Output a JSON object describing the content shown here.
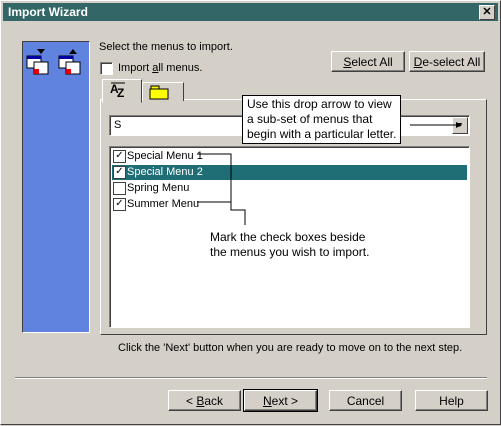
{
  "window": {
    "title": "Import Wizard",
    "close_glyph": "✕"
  },
  "prompt": "Select the menus to import.",
  "import_all": {
    "label_pre": "Import ",
    "label_ul": "a",
    "label_post": "ll menus.",
    "checked": false
  },
  "buttons": {
    "select_all_ul": "S",
    "select_all_rest": "elect All",
    "deselect_all_ul": "D",
    "deselect_all_rest": "e-select All",
    "back_ul": "B",
    "back_rest": "ack",
    "back_arrow": "<",
    "next_ul": "N",
    "next_rest": "ext",
    "next_arrow": ">",
    "cancel": "Cancel",
    "help": "Help"
  },
  "tabs": [
    {
      "icon": "az-sort-icon"
    },
    {
      "icon": "folder-icon"
    }
  ],
  "filter": {
    "value": "S",
    "arrow": "▼"
  },
  "menus": [
    {
      "label": "Special Menu 1",
      "checked": true,
      "selected": false
    },
    {
      "label": "Special Menu 2",
      "checked": true,
      "selected": true
    },
    {
      "label": "Spring Menu",
      "checked": false,
      "selected": false
    },
    {
      "label": "Summer Menu",
      "checked": true,
      "selected": false
    }
  ],
  "callout_dropdown": {
    "line1": "Use this drop arrow to view",
    "line2": "a sub-set of menus that",
    "line3": "begin with a particular letter."
  },
  "callout_checkboxes": {
    "line1": "Mark the check boxes beside",
    "line2": "the menus you wish to import."
  },
  "footer_hint": "Click the 'Next' button when you are ready to move on to the next step.",
  "check_glyph": "✓",
  "colors": {
    "titlebar": "#336666",
    "side_panel": "#6183e0",
    "selection": "#1f6e75"
  }
}
